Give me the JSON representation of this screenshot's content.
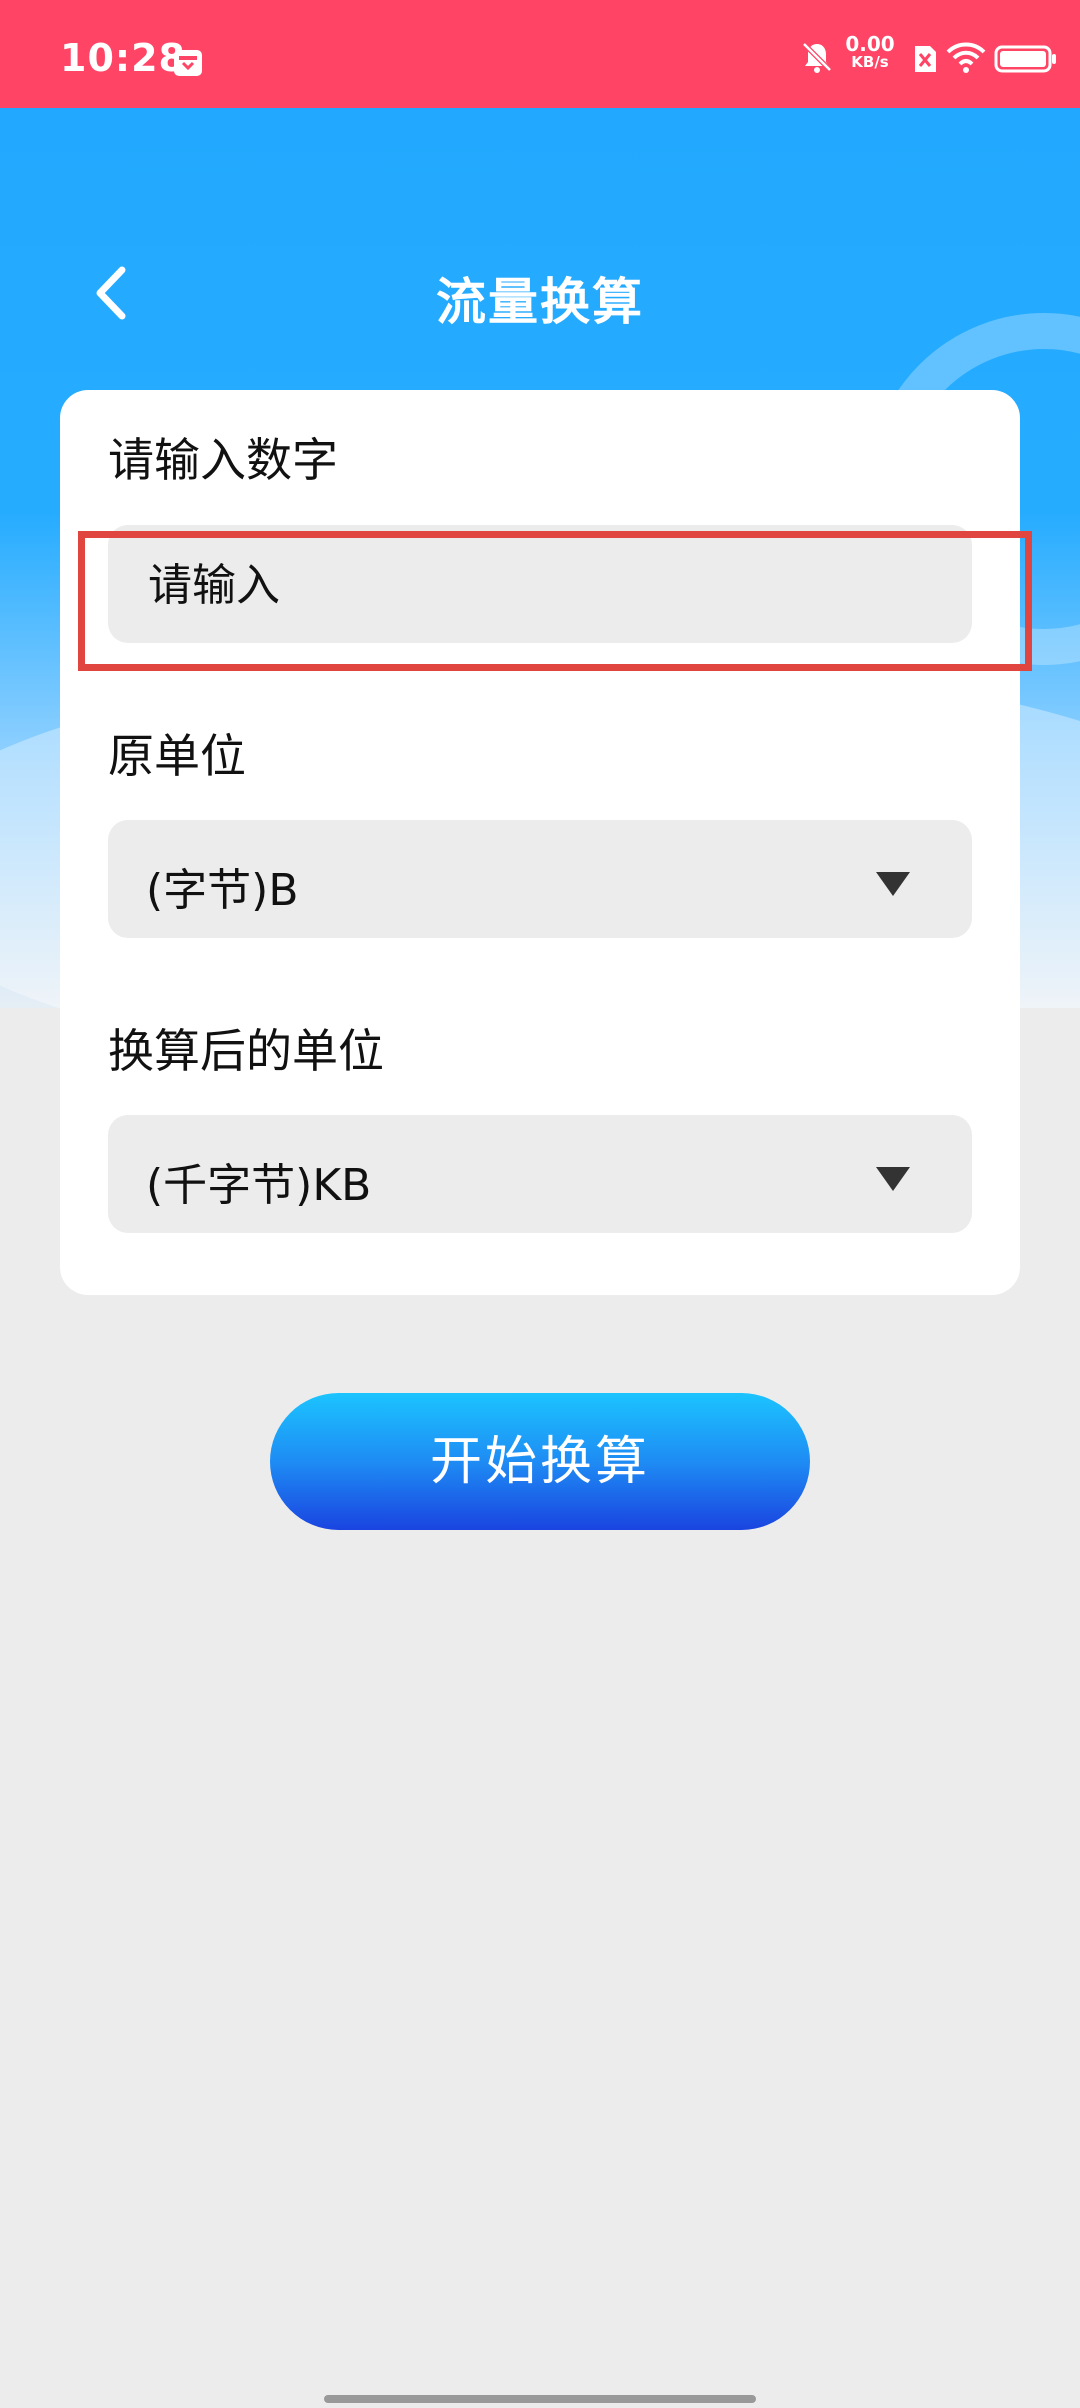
{
  "status_bar": {
    "time": "10:28",
    "net_speed_value": "0.00",
    "net_speed_unit": "KB/s",
    "icons": [
      "calendar-icon",
      "bell-mute-icon",
      "sim-off-icon",
      "wifi-icon",
      "battery-icon"
    ]
  },
  "header": {
    "title": "流量换算",
    "back_icon": "chevron-left-icon"
  },
  "form": {
    "number_label": "请输入数字",
    "number_placeholder": "请输入",
    "number_value": "",
    "source_unit_label": "原单位",
    "source_unit_value": "(字节)B",
    "target_unit_label": "换算后的单位",
    "target_unit_value": "(千字节)KB"
  },
  "actions": {
    "convert_label": "开始换算"
  },
  "colors": {
    "status_bar": "#ff4466",
    "header_blue": "#26acff",
    "button_top": "#1cc4ff",
    "button_bottom": "#1a44e0",
    "highlight": "#e0463f"
  }
}
